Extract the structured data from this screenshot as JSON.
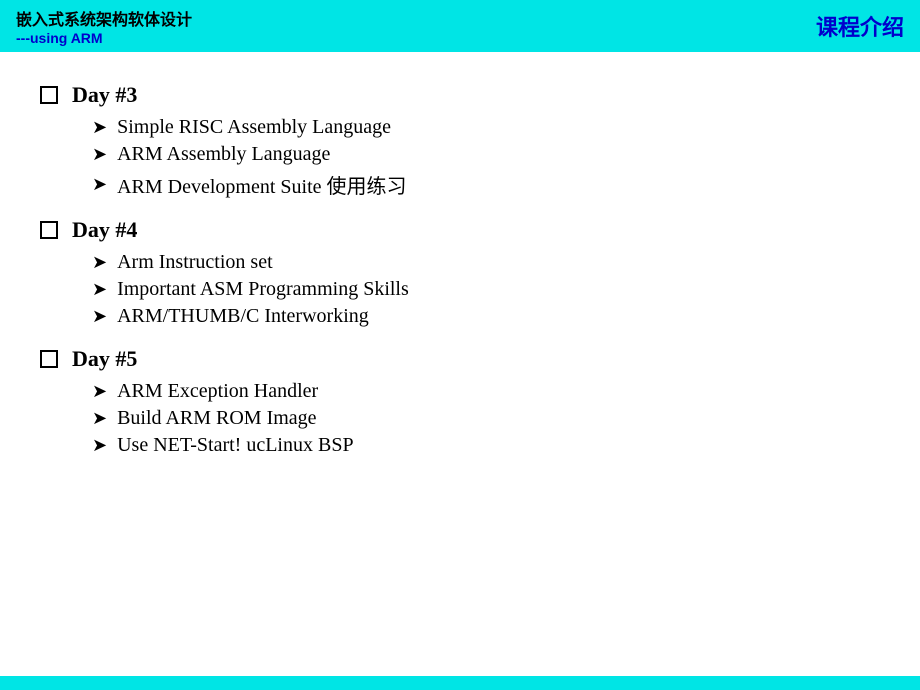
{
  "header": {
    "title_cn": "嵌入式系统架构软体设计",
    "subtitle": "---using ARM",
    "course_label": "课程介绍"
  },
  "days": [
    {
      "label": "Day #3",
      "items": [
        "Simple RISC Assembly Language",
        "ARM Assembly Language",
        "ARM Development Suite 使用练习"
      ]
    },
    {
      "label": "Day #4",
      "items": [
        "Arm Instruction set",
        "Important ASM Programming Skills",
        "ARM/THUMB/C Interworking"
      ]
    },
    {
      "label": "Day #5",
      "items": [
        "ARM Exception Handler",
        "Build ARM ROM Image",
        "Use NET-Start! ucLinux BSP"
      ]
    }
  ],
  "arrow_char": "➤",
  "checkbox_label": "checkbox"
}
